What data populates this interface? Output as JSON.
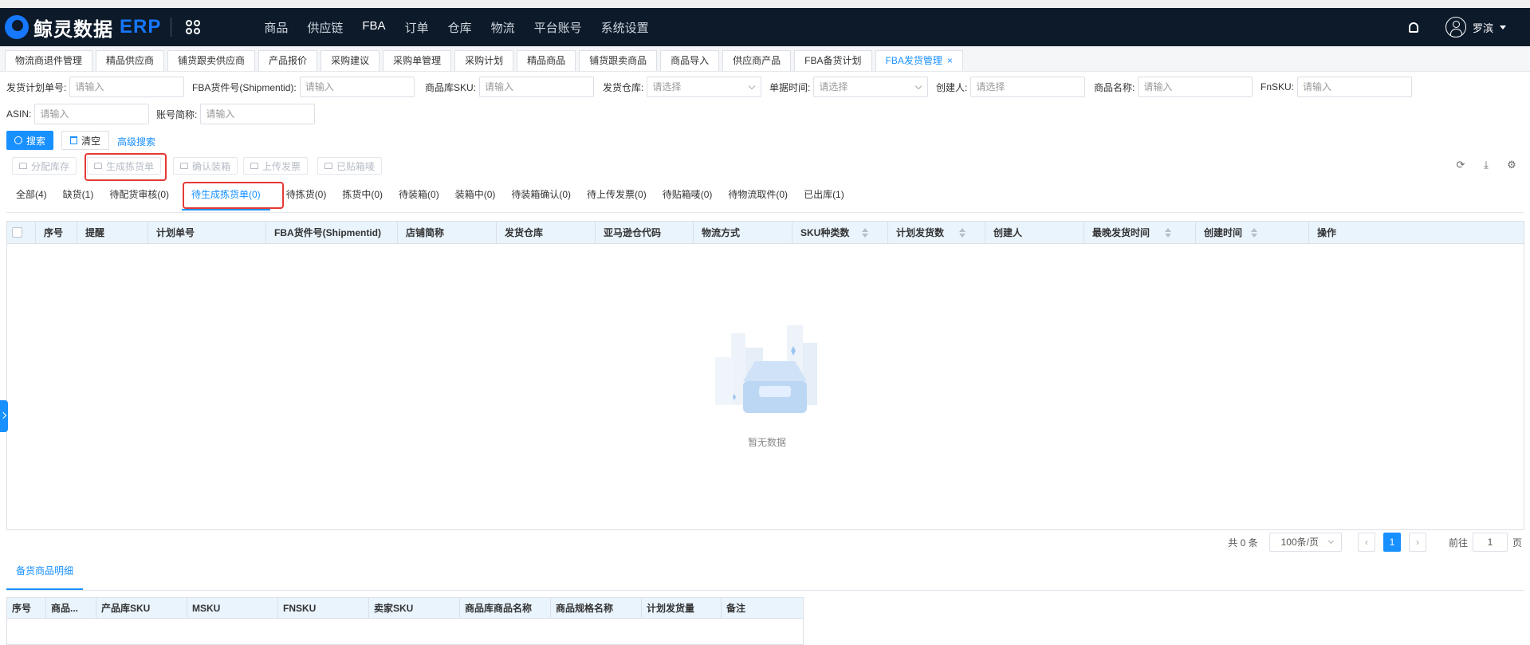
{
  "header": {
    "logo_text": "鲸灵数据",
    "logo_erp": "ERP",
    "nav": [
      "商品",
      "供应链",
      "FBA",
      "订单",
      "仓库",
      "物流",
      "平台账号",
      "系统设置"
    ],
    "active_nav": "FBA",
    "user_name": "罗滨"
  },
  "tabs": [
    {
      "label": "物流商退件管理"
    },
    {
      "label": "精品供应商"
    },
    {
      "label": "铺货跟卖供应商"
    },
    {
      "label": "产品报价"
    },
    {
      "label": "采购建议"
    },
    {
      "label": "采购单管理"
    },
    {
      "label": "采购计划"
    },
    {
      "label": "精品商品"
    },
    {
      "label": "铺货跟卖商品"
    },
    {
      "label": "商品导入"
    },
    {
      "label": "供应商产品"
    },
    {
      "label": "FBA备货计划"
    },
    {
      "label": "FBA发货管理"
    }
  ],
  "active_tab": "FBA发货管理",
  "filters": {
    "plan_no": {
      "label": "发货计划单号:",
      "placeholder": "请输入"
    },
    "shipment_id": {
      "label": "FBA货件号(Shipmentid):",
      "placeholder": "请输入"
    },
    "sku": {
      "label": "商品库SKU:",
      "placeholder": "请输入"
    },
    "warehouse": {
      "label": "发货仓库:",
      "placeholder": "请选择"
    },
    "doc_time": {
      "label": "单据时间:",
      "placeholder": "请选择"
    },
    "creator": {
      "label": "创建人:",
      "placeholder": "请选择"
    },
    "product_name": {
      "label": "商品名称:",
      "placeholder": "请输入"
    },
    "fnsku": {
      "label": "FnSKU:",
      "placeholder": "请输入"
    },
    "asin": {
      "label": "ASIN:",
      "placeholder": "请输入"
    },
    "account": {
      "label": "账号简称:",
      "placeholder": "请输入"
    }
  },
  "buttons": {
    "search": "搜索",
    "clear": "清空",
    "advanced": "高级搜索"
  },
  "actions": [
    "分配库存",
    "生成拣货单",
    "确认装箱",
    "上传发票",
    "已贴箱唛"
  ],
  "status_tabs": [
    {
      "label": "全部(4)"
    },
    {
      "label": "缺货(1)"
    },
    {
      "label": "待配货审核(0)"
    },
    {
      "label": "待生成拣货单(0)"
    },
    {
      "label": "待拣货(0)"
    },
    {
      "label": "拣货中(0)"
    },
    {
      "label": "待装箱(0)"
    },
    {
      "label": "装箱中(0)"
    },
    {
      "label": "待装箱确认(0)"
    },
    {
      "label": "待上传发票(0)"
    },
    {
      "label": "待贴箱唛(0)"
    },
    {
      "label": "待物流取件(0)"
    },
    {
      "label": "已出库(1)"
    }
  ],
  "active_status": "待生成拣货单(0)",
  "table": {
    "columns": [
      "序号",
      "提醒",
      "计划单号",
      "FBA货件号(Shipmentid)",
      "店铺简称",
      "发货仓库",
      "亚马逊仓代码",
      "物流方式",
      "SKU种类数",
      "计划发货数",
      "创建人",
      "最晚发货时间",
      "创建时间",
      "操作"
    ],
    "empty_text": "暂无数据"
  },
  "pagination": {
    "total": "共 0 条",
    "page_size": "100条/页",
    "current": "1",
    "goto_label": "前往",
    "goto_value": "1",
    "page_unit": "页"
  },
  "detail": {
    "tab": "备货商品明细",
    "columns": [
      "序号",
      "商品...",
      "产品库SKU",
      "MSKU",
      "FNSKU",
      "卖家SKU",
      "商品库商品名称",
      "商品规格名称",
      "计划发货量",
      "备注"
    ]
  }
}
